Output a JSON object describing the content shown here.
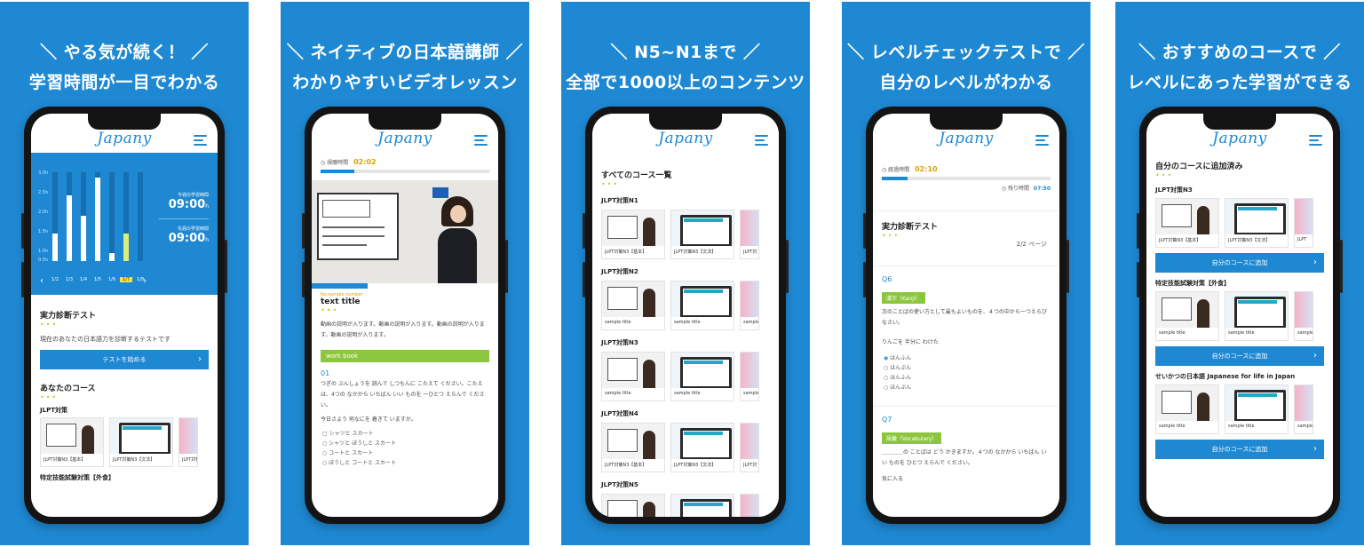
{
  "panels": [
    {
      "headline": [
        "＼ やる気が続く！ ／",
        "学習時間が一目でわかる"
      ],
      "logo": "Japany",
      "chart": {
        "y_ticks": [
          "3.0h",
          "2.5h",
          "2.0h",
          "1.5h",
          "1.0h",
          "0.5h"
        ],
        "x_labels": [
          "1/2",
          "1/3",
          "1/4",
          "1/5",
          "1/6",
          "1/7",
          "1/8"
        ],
        "values_h": [
          1.1,
          2.6,
          1.8,
          3.3,
          0.3,
          1.1,
          0
        ],
        "selected_index": 5,
        "stats": [
          {
            "label": "今週の学習時間",
            "value": "09:00",
            "unit": "h"
          },
          {
            "label": "先週の学習時間",
            "value": "09:00",
            "unit": "h"
          }
        ]
      },
      "test": {
        "title": "実力診断テスト",
        "desc": "現在のあなたの日本語力を診断するテストです",
        "button": "テストを始める"
      },
      "courses": {
        "title": "あなたのコース",
        "group": "JLPT対策",
        "captions": [
          "JLPT対策N3【基本】",
          "JLPT対策N3【文法】",
          "JLPT対策"
        ],
        "next_group": "特定技能試験対策【外食】"
      }
    },
    {
      "headline": [
        "＼ ネイティブの日本語講師 ／",
        "わかりやすいビデオレッスン"
      ],
      "logo": "Japany",
      "timer_label": "視聴時間",
      "timer": "02:02",
      "progress": 0.2,
      "video_tag": "No.sample number",
      "video_title": "text title",
      "description": "動画の説明が入ります。動画の説明が入ります。動画の説明が入ります。動画の説明が入ります。",
      "workbook_label": "work book",
      "question_no": "01",
      "question_text": "つぎの ぶんしょうを 読んで しつもんに こたえて ください。こたえは、4つの なかから いちばん いい ものを 一ひとつ えらんで ください。",
      "question_sub": "今日さよう 何なにを 着きて いますか。",
      "options": [
        "シャツと スカート",
        "シャツと ぼうしと スカート",
        "コートと スカート",
        "ぼうしと コートと スカート"
      ]
    },
    {
      "headline": [
        "＼ N5~N1まで ／",
        "全部で1000以上のコンテンツ"
      ],
      "logo": "Japany",
      "list_title": "すべてのコース一覧",
      "groups": [
        {
          "name": "JLPT対策N1",
          "captions": [
            "JLPT対策N3【基本】",
            "JLPT対策N3【文法】",
            "JLPT対"
          ]
        },
        {
          "name": "JLPT対策N2",
          "captions": [
            "sample title",
            "sample title",
            "sample"
          ]
        },
        {
          "name": "JLPT対策N3",
          "captions": [
            "sample title",
            "sample title",
            "sample"
          ]
        },
        {
          "name": "JLPT対策N4",
          "captions": [
            "JLPT対策N3【基本】",
            "JLPT対策N3【文法】",
            "JLPT対"
          ]
        },
        {
          "name": "JLPT対策N5",
          "captions": [
            "",
            "",
            ""
          ]
        }
      ]
    },
    {
      "headline": [
        "＼ レベルチェックテストで ／",
        "自分のレベルがわかる"
      ],
      "logo": "Japany",
      "timer_label": "経過時間",
      "timer": "02:10",
      "remaining_label": "残り時間",
      "remaining": "07:50",
      "progress": 0.15,
      "test_title": "実力診断テスト",
      "page": "2/2",
      "page_unit": "ページ",
      "q6": {
        "no": "Q6",
        "tag": "漢字（Kanji）",
        "text": "次のことばの使い方として最もよいものを、４つの中から一つえらびなさい。",
        "sentence": "りんごを 半分に わけた",
        "options": [
          "はんふん",
          "はんぷん",
          "ほんふん",
          "ほんぷん"
        ]
      },
      "q7": {
        "no": "Q7",
        "tag": "語彙（Vocabulary）",
        "text": "＿＿＿＿の ことばは どう かきますか。４つの なかから いちばん いい ものを ひとつ えらんで ください。",
        "sentence": "気に入る"
      }
    },
    {
      "headline": [
        "＼ おすすめのコースで ／",
        "レベルにあった学習ができる"
      ],
      "logo": "Japany",
      "list_title": "自分のコースに追加済み",
      "groups": [
        {
          "name": "JLPT対策N3",
          "captions": [
            "JLPT対策N3【基本】",
            "JLPT対策N3【文法】",
            "JLPT"
          ]
        },
        {
          "name": "特定技能試験対策【外食】",
          "captions": [
            "sample title",
            "sample title",
            "sample"
          ]
        },
        {
          "name": "せいかつの日本語 Japanese for life in Japan",
          "captions": [
            "sample title",
            "sample title",
            "sample"
          ]
        }
      ],
      "add_button": "自分のコースに追加"
    }
  ]
}
